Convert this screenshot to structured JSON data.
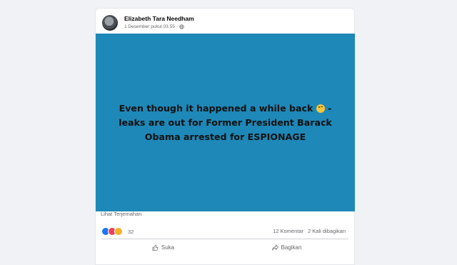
{
  "post": {
    "author": "Elizabeth Tara Needham",
    "timestamp": "1 Desember pukul 03.55",
    "audience_icon": "globe-icon",
    "image_text_line1": "Even though it happened a while back",
    "image_text_line2": "leaks are out for Former President Barack Obama arrested for ESPIONAGE",
    "image_text_dash": "-",
    "image_background": "#1e88b8",
    "translate_link": "Lihat Terjemahan",
    "reaction_count": "32",
    "comments": "12 Komentar",
    "shares": "2 Kali dibagikan"
  },
  "actions": {
    "like_label": "Suka",
    "share_label": "Bagikan"
  }
}
